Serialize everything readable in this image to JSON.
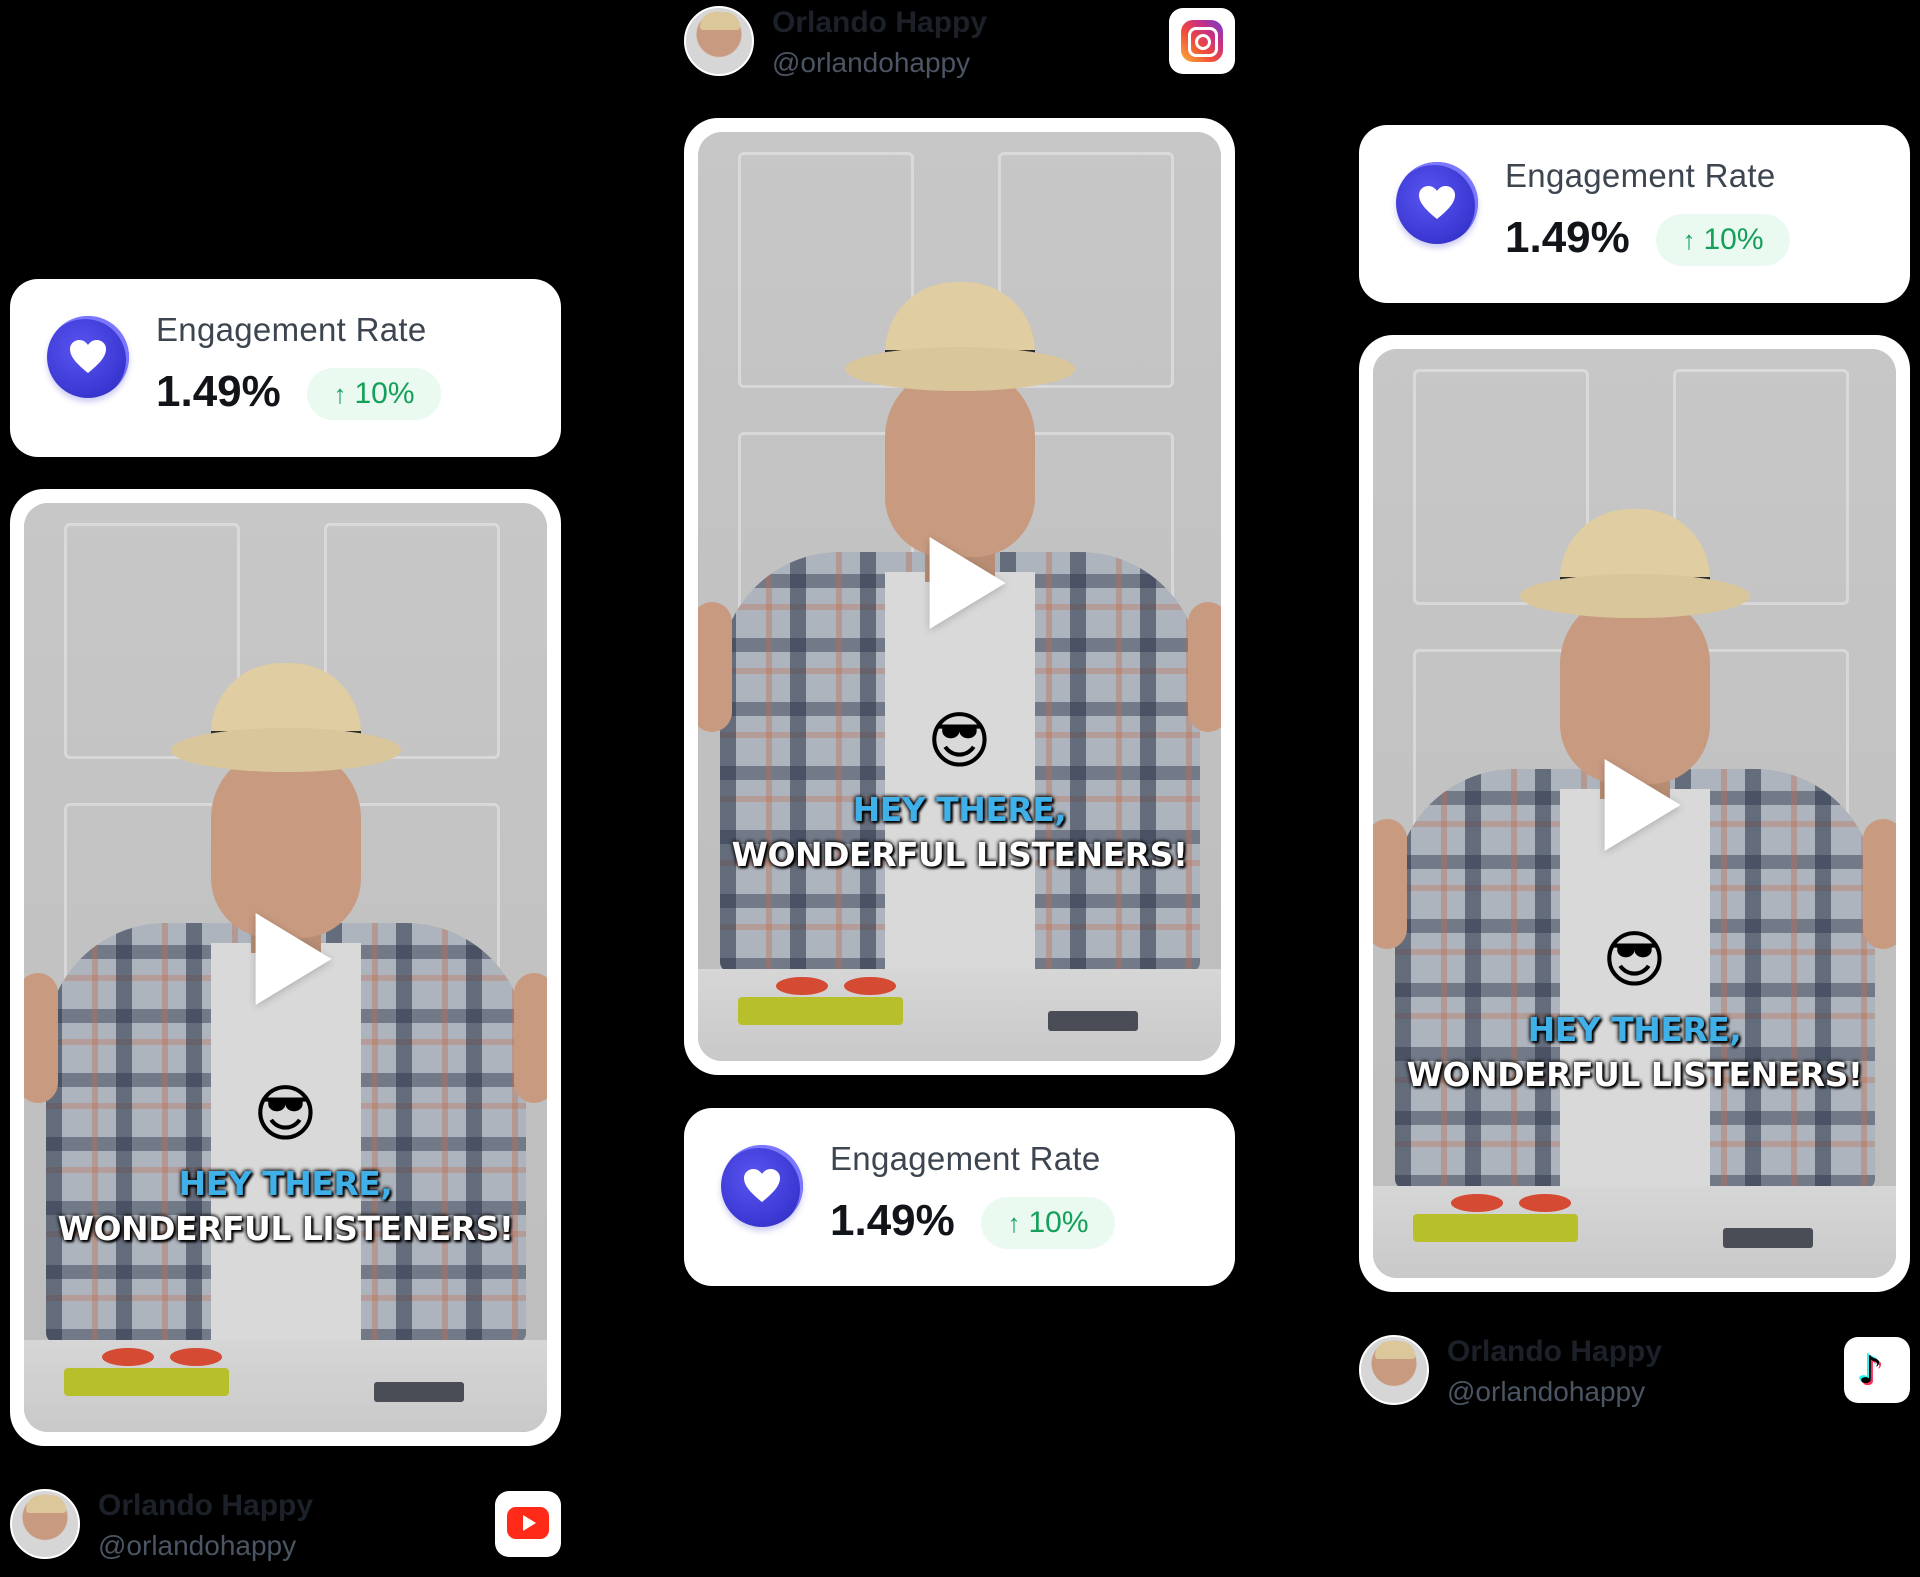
{
  "engagement": {
    "label": "Engagement Rate",
    "value": "1.49%",
    "change": "10%",
    "change_direction": "up",
    "change_color": "#14a05a",
    "icon": "heart-icon",
    "icon_color": "#3d3ad6"
  },
  "profile": {
    "name": "Orlando Happy",
    "handle": "@orlandohappy"
  },
  "video": {
    "caption_line1": "HEY THERE,",
    "caption_line2": "WONDERFUL LISTENERS!",
    "emoji": "😎",
    "caption_highlight_color": "#3fb0e8"
  },
  "platforms": [
    {
      "name": "YouTube",
      "icon": "youtube-icon"
    },
    {
      "name": "Instagram",
      "icon": "instagram-icon"
    },
    {
      "name": "TikTok",
      "icon": "tiktok-icon"
    }
  ],
  "theme": {
    "background": "#000000",
    "card_background": "#ffffff"
  }
}
